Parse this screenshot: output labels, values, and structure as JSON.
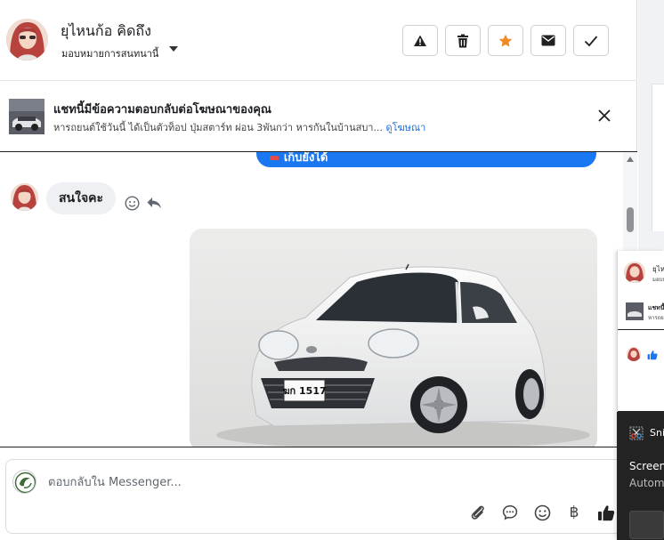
{
  "header": {
    "contact_name": "ยุไหนก้อ คิดถึง",
    "assign_label": "มอบหมายการสนทนานี้",
    "actions": [
      "spam-icon",
      "trash-icon",
      "star-icon",
      "envelope-icon",
      "check-icon"
    ]
  },
  "ad": {
    "title": "แชทนี้มีข้อความตอบกลับต่อโฆษณาของคุณ",
    "description": "หารถยนต์ใช้วันนี้ ได้เป็นตัวท็อป ปุ่มสตาร์ท ผ่อน 3พันกว่า หารกันในบ้านสบา...",
    "link_label": "ดูโฆษณา"
  },
  "messages": {
    "partial_outgoing": "เก็บยังได้",
    "incoming_text": "สนใจคะ",
    "car_plate": "ฆก 1517"
  },
  "composer": {
    "placeholder": "ตอบกลับใน Messenger...",
    "currency_symbol": "฿"
  },
  "mini_window": {
    "name": "ยุไห",
    "sub": "มอบห",
    "ad_title": "แชทนี้",
    "ad_desc": "หารถย"
  },
  "toast": {
    "app": "Sni",
    "title": "Screen",
    "body": "Autom"
  },
  "colors": {
    "accent": "#1a77f2",
    "link": "#216fdb",
    "star": "#f08a24"
  }
}
